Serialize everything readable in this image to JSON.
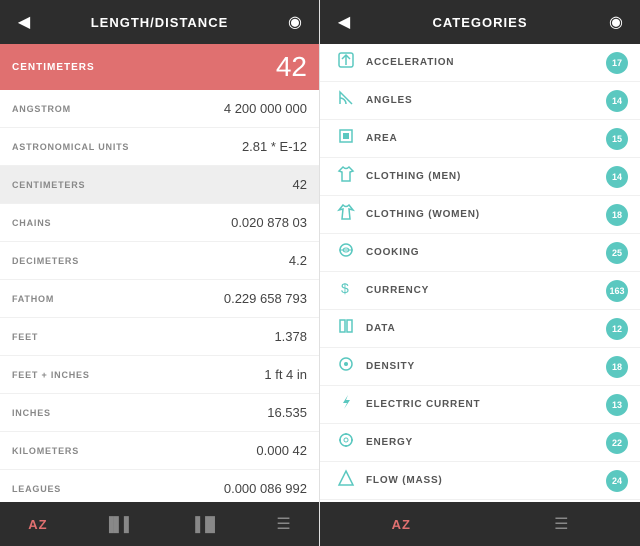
{
  "left": {
    "header": {
      "title": "LENGTH/DISTANCE",
      "back_icon": "◀",
      "info_icon": "◉"
    },
    "active": {
      "label": "CENTIMETERS",
      "value": "42"
    },
    "rows": [
      {
        "name": "ANGSTROM",
        "value": "4 200 000 000",
        "highlighted": false
      },
      {
        "name": "ASTRONOMICAL UNITS",
        "value": "2.81 * E-12",
        "highlighted": false
      },
      {
        "name": "CENTIMETERS",
        "value": "42",
        "highlighted": true
      },
      {
        "name": "CHAINS",
        "value": "0.020 878 03",
        "highlighted": false
      },
      {
        "name": "DECIMETERS",
        "value": "4.2",
        "highlighted": false
      },
      {
        "name": "FATHOM",
        "value": "0.229 658 793",
        "highlighted": false
      },
      {
        "name": "FEET",
        "value": "1.378",
        "highlighted": false
      },
      {
        "name": "FEET + INCHES",
        "value": "1 ft 4 in",
        "highlighted": false
      },
      {
        "name": "INCHES",
        "value": "16.535",
        "highlighted": false
      },
      {
        "name": "KILOMETERS",
        "value": "0.000 42",
        "highlighted": false
      },
      {
        "name": "LEAGUES",
        "value": "0.000 086 992",
        "highlighted": false
      }
    ],
    "footer": {
      "sort_label": "AZ",
      "bar_icon": "▐▌",
      "bar2_icon": "▐▐▌",
      "menu_icon": "☰"
    }
  },
  "right": {
    "header": {
      "title": "CATEGORIES",
      "back_icon": "◀",
      "info_icon": "◉"
    },
    "categories": [
      {
        "name": "ACCELERATION",
        "icon": "⚡",
        "icon_type": "acceleration",
        "count": "17"
      },
      {
        "name": "ANGLES",
        "icon": "△",
        "icon_type": "angles",
        "count": "14"
      },
      {
        "name": "AREA",
        "icon": "▣",
        "icon_type": "area",
        "count": "15"
      },
      {
        "name": "CLOTHING (MEN)",
        "icon": "👕",
        "icon_type": "clothing-men",
        "count": "14"
      },
      {
        "name": "CLOTHING (WOMEN)",
        "icon": "👗",
        "icon_type": "clothing-women",
        "count": "18"
      },
      {
        "name": "COOKING",
        "icon": "⊙",
        "icon_type": "cooking",
        "count": "25"
      },
      {
        "name": "CURRENCY",
        "icon": "$",
        "icon_type": "currency",
        "count": "163"
      },
      {
        "name": "DATA",
        "icon": "▯▯",
        "icon_type": "data",
        "count": "12"
      },
      {
        "name": "DENSITY",
        "icon": "◎",
        "icon_type": "density",
        "count": "18"
      },
      {
        "name": "ELECTRIC CURRENT",
        "icon": "⚡",
        "icon_type": "electric",
        "count": "13"
      },
      {
        "name": "ENERGY",
        "icon": "✿",
        "icon_type": "energy",
        "count": "22"
      },
      {
        "name": "FLOW (MASS)",
        "icon": "△",
        "icon_type": "flow",
        "count": "24"
      }
    ],
    "footer": {
      "sort_label": "AZ",
      "menu_icon": "☰"
    }
  }
}
